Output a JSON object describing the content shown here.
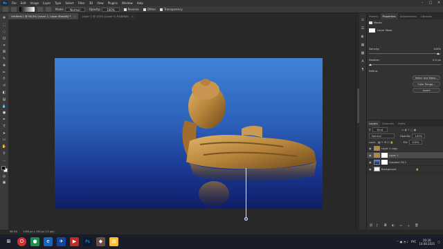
{
  "app": {
    "logo": "Ps"
  },
  "menu": [
    "File",
    "Edit",
    "Image",
    "Layer",
    "Type",
    "Select",
    "Filter",
    "3D",
    "View",
    "Plugins",
    "Window",
    "Help"
  ],
  "options": {
    "size": "4",
    "mode_label": "Mode:",
    "mode": "Normal",
    "opacity_label": "Opacity:",
    "opacity": "100%",
    "reverse": "Reverse",
    "dither": "Dither",
    "transparency": "Transparency"
  },
  "tabs": [
    {
      "label": "Untitled-1 @ 96.5% (Layer 1, Layer Mask/8) *",
      "active": true
    },
    {
      "label": "Layer 1 @ 100% (Layer 0, RGB/8#)",
      "active": false
    }
  ],
  "properties": {
    "tabs": [
      "History",
      "Properties",
      "Adjustments",
      "Libraries"
    ],
    "masks_label": "Masks",
    "layer_mask_label": "Layer Mask",
    "density_label": "Density:",
    "density": "100%",
    "feather_label": "Feather:",
    "feather": "0.0 px",
    "refine_label": "Refine:",
    "buttons": [
      "Select and Mask...",
      "Color Range...",
      "Invert"
    ]
  },
  "layers": {
    "tabs": [
      "Layers",
      "Channels",
      "Paths"
    ],
    "kind_label": "Kind",
    "blend": "Normal",
    "opacity_label": "Opacity:",
    "opacity": "100%",
    "lock_label": "Lock:",
    "fill_label": "Fill:",
    "fill": "100%",
    "items": [
      {
        "name": "Layer 1 copy",
        "selected": false,
        "thumb": "gold"
      },
      {
        "name": "Layer 1",
        "selected": true,
        "thumb": "gold",
        "mask": true
      },
      {
        "name": "Gradient Fill 1",
        "selected": false,
        "thumb": "dark",
        "mask": true
      },
      {
        "name": "Background",
        "selected": false,
        "thumb": "white"
      }
    ]
  },
  "status": {
    "zoom": "96.5%",
    "doc": "1280 px x 720 px (72 ppi)"
  },
  "tray": {
    "lang": "PYC",
    "time": "20:20",
    "date": "14.08.2021"
  }
}
